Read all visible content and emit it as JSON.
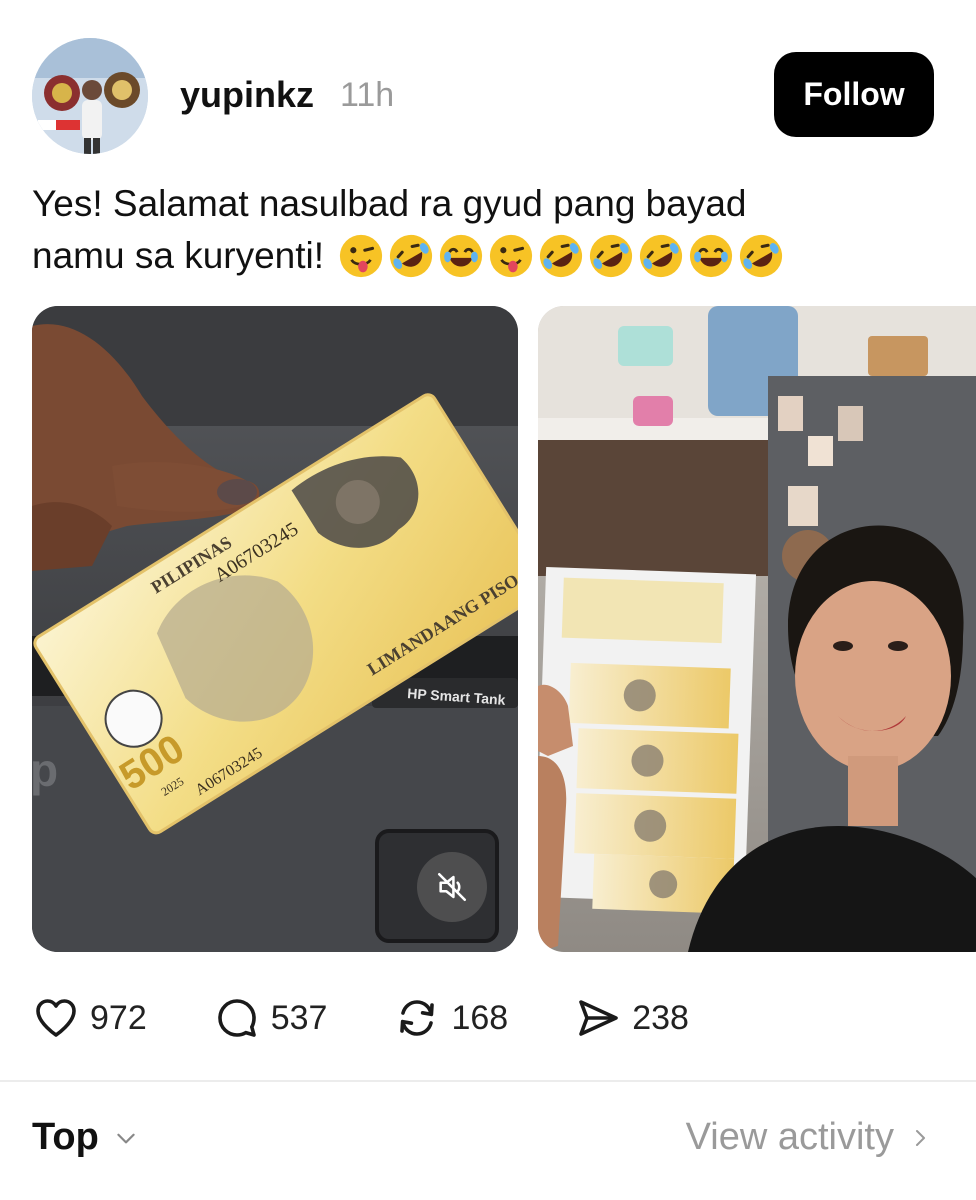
{
  "post": {
    "username": "yupinkz",
    "timestamp": "11h",
    "follow_label": "Follow",
    "caption_line1": "Yes! Salamat nasulbad ra gyud pang bayad",
    "caption_line2": "namu sa kuryenti!",
    "caption_emojis": [
      "winking-tongue-emoji",
      "rofl-emoji",
      "joy-emoji",
      "winking-tongue-emoji",
      "rofl-emoji",
      "rofl-emoji",
      "rofl-emoji",
      "joy-emoji",
      "rofl-emoji"
    ]
  },
  "media": [
    {
      "name": "photo-banknote-printer",
      "banknote_text": [
        "PILIPINAS",
        "LIMANDAANG PISO",
        "A06703245",
        "2025",
        "500"
      ],
      "printer_label": "HP Smart Tank"
    },
    {
      "name": "photo-woman-banknotes"
    }
  ],
  "actions": {
    "likes": "972",
    "comments": "537",
    "reposts": "168",
    "shares": "238"
  },
  "footer": {
    "sort_label": "Top",
    "view_activity_label": "View activity"
  },
  "colors": {
    "accent": "#000000",
    "muted_text": "#9a9a9a",
    "banknote_yellow": "#f0d77a"
  }
}
